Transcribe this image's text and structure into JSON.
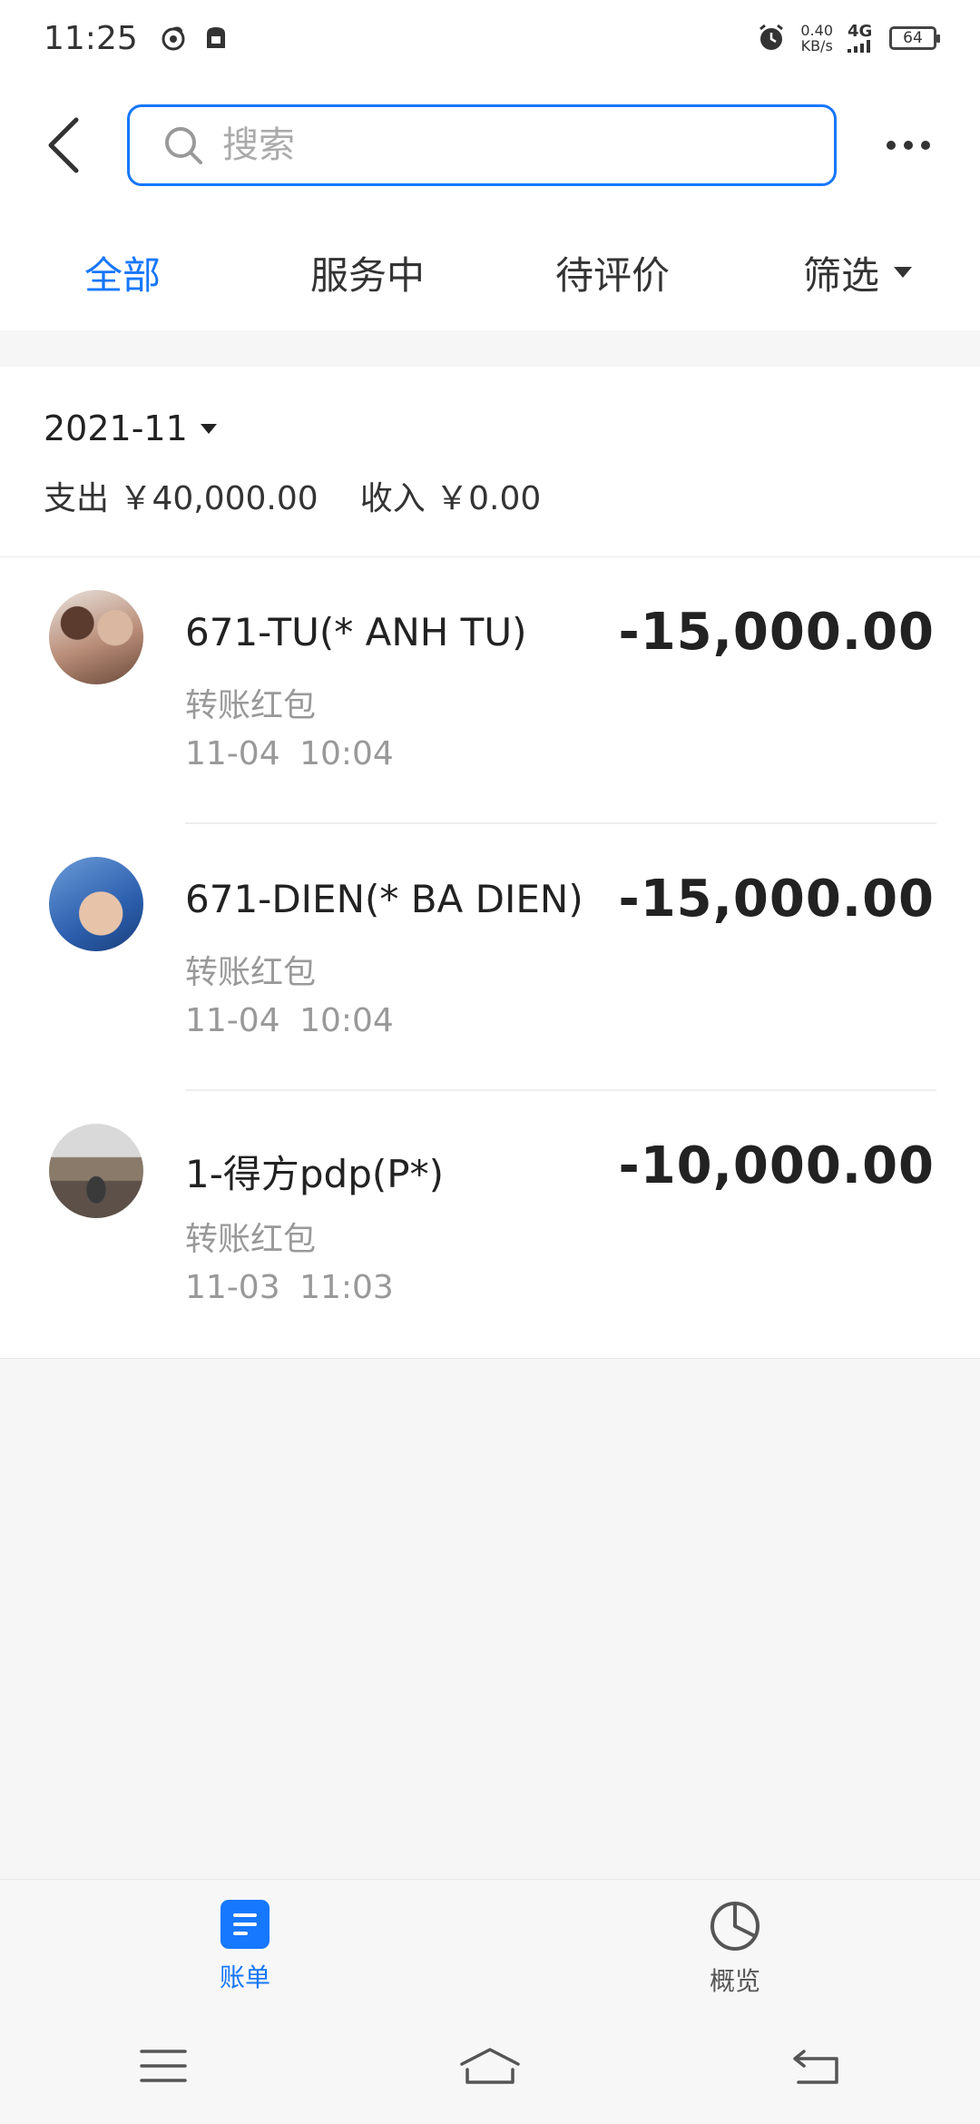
{
  "status_bar": {
    "time": "11:25",
    "speed_value": "0.40",
    "speed_unit": "KB/s",
    "network": "4G",
    "battery": "64"
  },
  "search": {
    "placeholder": "搜索",
    "value": ""
  },
  "tabs": [
    {
      "label": "全部",
      "active": true
    },
    {
      "label": "服务中",
      "active": false
    },
    {
      "label": "待评价",
      "active": false
    },
    {
      "label": "筛选",
      "active": false
    }
  ],
  "summary": {
    "month": "2021-11",
    "expense_label": "支出",
    "expense_value": "￥40,000.00",
    "income_label": "收入",
    "income_value": "￥0.00"
  },
  "transactions": [
    {
      "name": "671-TU(* ANH TU)",
      "type": "转账红包",
      "date": "11-04",
      "time": "10:04",
      "amount": "-15,000.00"
    },
    {
      "name": "671-DIEN(* BA DIEN)",
      "type": "转账红包",
      "date": "11-04",
      "time": "10:04",
      "amount": "-15,000.00"
    },
    {
      "name": "1-得方pdp(P*)",
      "type": "转账红包",
      "date": "11-03",
      "time": "11:03",
      "amount": "-10,000.00"
    }
  ],
  "bottom_nav": [
    {
      "label": "账单",
      "icon": "bill-icon",
      "active": true
    },
    {
      "label": "概览",
      "icon": "pie-chart-icon",
      "active": false
    }
  ],
  "colors": {
    "accent": "#1677ff",
    "text": "#222222",
    "muted": "#999999"
  }
}
